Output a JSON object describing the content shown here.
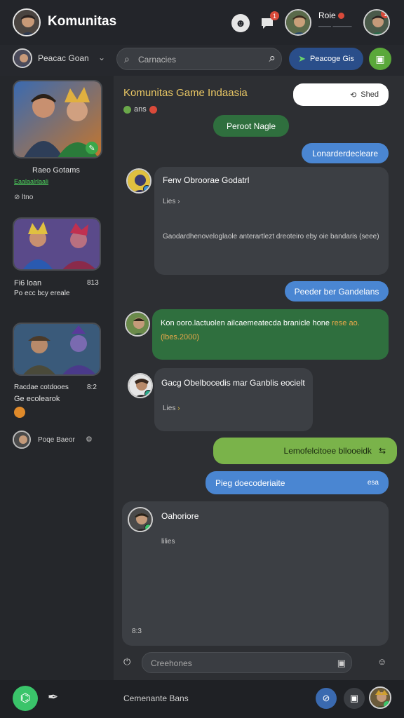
{
  "header": {
    "title": "Komunitas",
    "notification_badge": "1",
    "user_name": "Roie",
    "user_subtitle": "—— ———",
    "theme_color": "#23252a"
  },
  "subheader": {
    "group_name": "Peacac Goan",
    "search_placeholder": "Carnacies",
    "join_label": "Peacoge Gis"
  },
  "sidebar": {
    "cards": [
      {
        "title": "Raeo Gotams",
        "link": "Eaalaalrlaali",
        "meta": "ltno"
      },
      {
        "title": "Fi6 loan",
        "subtitle": "Po ecc bcy ereale",
        "count": "813"
      },
      {
        "title": "Racdae cotdooes",
        "subtitle": "Ge ecolearok",
        "count": "8:2"
      }
    ],
    "user": {
      "name": "Poqe Baeor"
    }
  },
  "chat": {
    "title": "Komunitas Game Indaasia",
    "subtitle": "ans",
    "search_button": "Shed",
    "pills": [
      {
        "text": "Peroot Nagle"
      },
      {
        "text": "Lonarderdecleare"
      },
      {
        "text": "Peeder ber Gandelans"
      }
    ],
    "messages": [
      {
        "title": "Fenv Obroorae Godatrl",
        "meta": "Lies",
        "body": "Gaodardhenoveloglaole anterartlezt dreoteiro eby oie bandaris (seee)"
      },
      {
        "title": "Kon ooro.lactuolen ailcaemeatecda branicle hone",
        "highlight_1": "rese",
        "highlight_2": "ao.(lbes.2000)"
      },
      {
        "title": "Gacg Obelbocedis mar Ganblis eocielt",
        "meta": "Lies"
      },
      {
        "text": "Lemofelcitoee bllooeidk"
      },
      {
        "text": "Pieg doecoderiaite",
        "meta": "esa"
      },
      {
        "title": "Oahoriore",
        "meta": "lilies",
        "footer": "8:3"
      }
    ],
    "composer_placeholder": "Creehones"
  },
  "bottom": {
    "label": "Cemenante Bans"
  },
  "colors": {
    "accent_green": "#3ac46a",
    "accent_blue": "#4a86d2",
    "accent_lime": "#7ab34a",
    "title_gold": "#e8c664",
    "badge_red": "#d94a3a"
  }
}
